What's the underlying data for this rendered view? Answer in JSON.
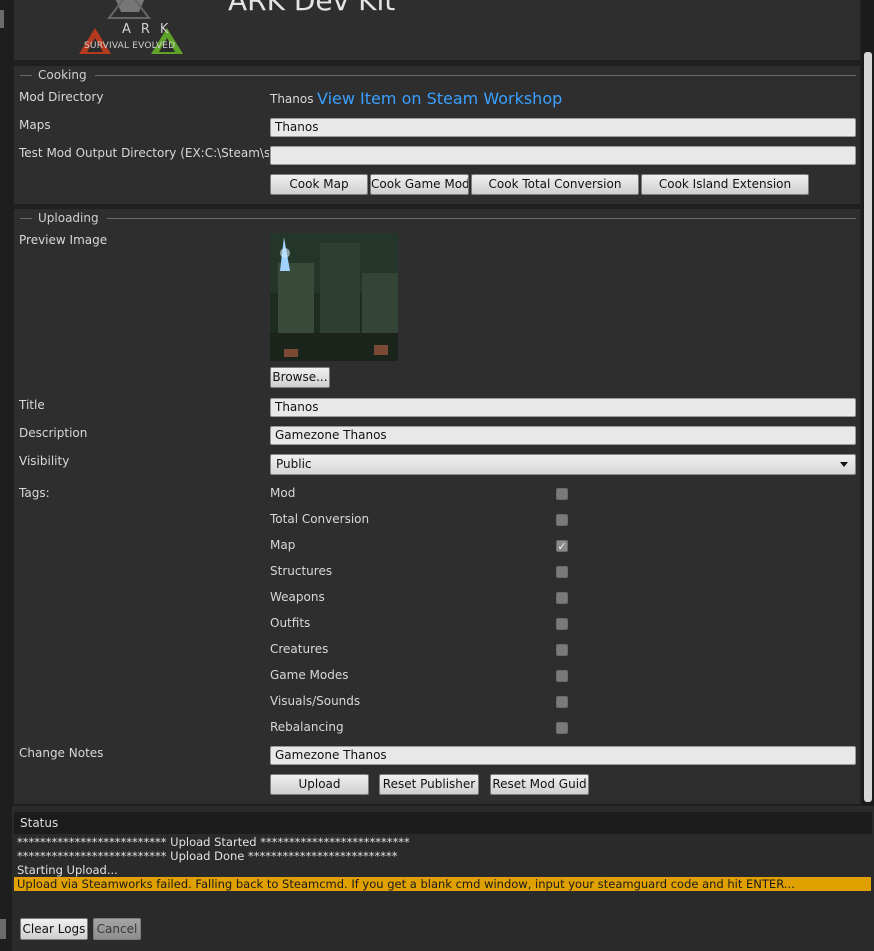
{
  "header": {
    "app_title": "ARK Dev Kit",
    "logo_text": "ARK",
    "logo_subtitle": "SURVIVAL EVOLVED"
  },
  "cooking": {
    "section_title": "Cooking",
    "mod_directory_label": "Mod Directory",
    "mod_directory_value": "Thanos",
    "workshop_link": "View Item on Steam Workshop",
    "maps_label": "Maps",
    "maps_value": "Thanos",
    "output_dir_label": "Test Mod Output Directory (EX:C:\\Steam\\steam",
    "output_dir_value": "",
    "buttons": [
      "Cook Map",
      "Cook Game Mod",
      "Cook Total Conversion",
      "Cook Island Extension"
    ]
  },
  "uploading": {
    "section_title": "Uploading",
    "preview_image_label": "Preview Image",
    "browse_label": "Browse...",
    "title_label": "Title",
    "title_value": "Thanos",
    "description_label": "Description",
    "description_value": "Gamezone Thanos",
    "visibility_label": "Visibility",
    "visibility_value": "Public",
    "tags_label": "Tags:",
    "tags": [
      {
        "name": "Mod",
        "checked": false
      },
      {
        "name": "Total Conversion",
        "checked": false
      },
      {
        "name": "Map",
        "checked": true
      },
      {
        "name": "Structures",
        "checked": false
      },
      {
        "name": "Weapons",
        "checked": false
      },
      {
        "name": "Outfits",
        "checked": false
      },
      {
        "name": "Creatures",
        "checked": false
      },
      {
        "name": "Game Modes",
        "checked": false
      },
      {
        "name": "Visuals/Sounds",
        "checked": false
      },
      {
        "name": "Rebalancing",
        "checked": false
      }
    ],
    "change_notes_label": "Change Notes",
    "change_notes_value": "Gamezone Thanos",
    "upload_label": "Upload",
    "reset_publisher_label": "Reset Publisher",
    "reset_mod_guid_label": "Reset Mod Guid"
  },
  "status": {
    "title": "Status",
    "logs": [
      "************************** Upload Started **************************",
      "************************** Upload Done **************************",
      "Starting Upload..."
    ],
    "warning": "Upload via Steamworks failed. Falling back to Steamcmd. If you get a blank cmd window, input your steamguard code and hit ENTER...",
    "clear_logs_label": "Clear Logs",
    "cancel_label": "Cancel"
  },
  "colors": {
    "background": "#2e2e2e",
    "link": "#3aa0ff",
    "warning_bg": "#e0a000"
  }
}
